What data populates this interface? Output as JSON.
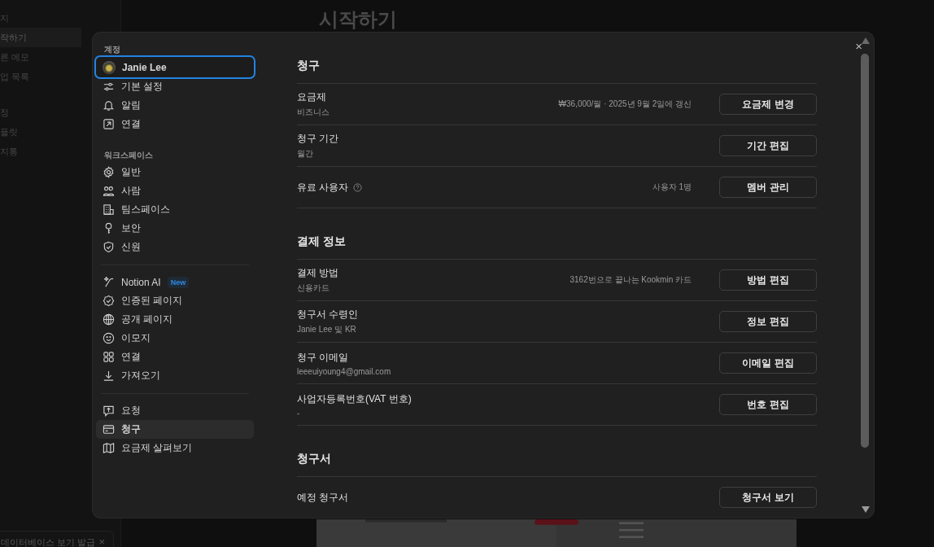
{
  "background": {
    "page_title": "시작하기",
    "sidebar_items": [
      {
        "label": "지",
        "selected": false
      },
      {
        "label": "작하기",
        "selected": true
      },
      {
        "label": "른 메모",
        "selected": false
      },
      {
        "label": "업 목록",
        "selected": false
      },
      {
        "label": "정",
        "selected": false
      },
      {
        "label": "플릿",
        "selected": false
      },
      {
        "label": "지통",
        "selected": false
      }
    ],
    "toast": {
      "text": "데이터베이스 보기 발급",
      "close": "×"
    }
  },
  "modal": {
    "close": "×",
    "sidebar": [
      {
        "title": "계정",
        "items": [
          {
            "label": "Janie Lee",
            "selected": false,
            "focused": true
          },
          {
            "label": "기본 설정",
            "selected": false,
            "focused": false
          },
          {
            "label": "알림",
            "selected": false,
            "focused": false
          },
          {
            "label": "연결",
            "selected": false,
            "focused": false
          }
        ]
      },
      {
        "title": "워크스페이스",
        "items": [
          {
            "label": "일반",
            "selected": false,
            "focused": false
          },
          {
            "label": "사람",
            "selected": false,
            "focused": false
          },
          {
            "label": "팀스페이스",
            "selected": false,
            "focused": false
          },
          {
            "label": "보안",
            "selected": false,
            "focused": false
          },
          {
            "label": "신원",
            "selected": false,
            "focused": false
          }
        ]
      },
      {
        "items": [
          {
            "label": "Notion AI",
            "badge": "New",
            "selected": false,
            "focused": false
          },
          {
            "label": "인증된 페이지",
            "selected": false,
            "focused": false
          },
          {
            "label": "공개 페이지",
            "selected": false,
            "focused": false
          },
          {
            "label": "이모지",
            "selected": false,
            "focused": false
          },
          {
            "label": "연결",
            "selected": false,
            "focused": false
          },
          {
            "label": "가져오기",
            "selected": false,
            "focused": false
          }
        ]
      },
      {
        "items": [
          {
            "label": "요청",
            "selected": false,
            "focused": false
          },
          {
            "label": "청구",
            "selected": true,
            "focused": false
          },
          {
            "label": "요금제 살펴보기",
            "selected": false,
            "focused": false
          }
        ]
      }
    ],
    "sections": [
      {
        "title": "청구",
        "rows": [
          {
            "label": "요금제",
            "sublabel": "비즈니스",
            "info": "₩36,000/월 · 2025년 9월 2일에 갱신",
            "help": false,
            "button": "요금제 변경"
          },
          {
            "label": "청구 기간",
            "sublabel": "월간",
            "help": false,
            "button": "기간 편집"
          },
          {
            "label": "유료 사용자",
            "info": "사용자 1명",
            "help": true,
            "button": "멤버 관리"
          }
        ]
      },
      {
        "title": "결제 정보",
        "rows": [
          {
            "label": "결제 방법",
            "sublabel": "신용카드",
            "info": "3162번으로 끝나는 Kookmin 카드",
            "help": false,
            "button": "방법 편집"
          },
          {
            "label": "청구서 수령인",
            "sublabel": "Janie Lee 및 KR",
            "help": false,
            "button": "정보 편집"
          },
          {
            "label": "청구 이메일",
            "sublabel": "leeeuiyoung4@gmail.com",
            "help": false,
            "button": "이메일 편집"
          },
          {
            "label": "사업자등록번호(VAT 번호)",
            "sublabel": "-",
            "help": false,
            "button": "번호 편집"
          }
        ]
      },
      {
        "title": "청구서",
        "rows": [
          {
            "label": "예정 청구서",
            "help": false,
            "button": "청구서 보기"
          }
        ]
      }
    ]
  }
}
